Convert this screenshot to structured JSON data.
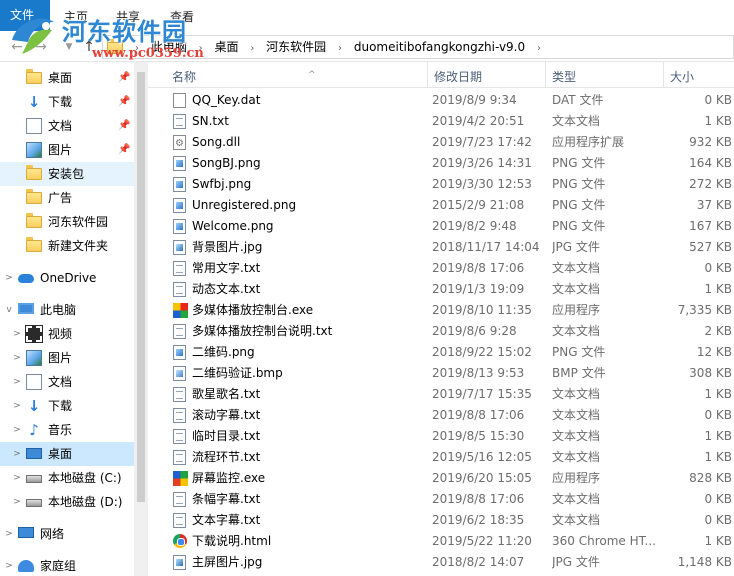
{
  "ribbon": {
    "tabs": [
      "文件",
      "主页",
      "共享",
      "查看"
    ]
  },
  "address": {
    "crumbs": [
      "此电脑",
      "桌面",
      "河东软件园",
      "duomeitibofangkongzhi-v9.0"
    ]
  },
  "watermark": {
    "title": "河东软件园",
    "url": "www.pc0359.cn"
  },
  "nav": {
    "items": [
      {
        "label": "桌面",
        "icon": "folder-icon",
        "pinned": true
      },
      {
        "label": "下载",
        "icon": "download-icon",
        "pinned": true
      },
      {
        "label": "文档",
        "icon": "document-icon",
        "pinned": true
      },
      {
        "label": "图片",
        "icon": "picture-icon",
        "pinned": true
      },
      {
        "label": "安装包",
        "icon": "folder-icon",
        "pinned": false
      },
      {
        "label": "广告",
        "icon": "folder-icon",
        "pinned": false
      },
      {
        "label": "河东软件园",
        "icon": "folder-icon",
        "pinned": false
      },
      {
        "label": "新建文件夹",
        "icon": "folder-icon",
        "pinned": false
      },
      {
        "label": "OneDrive",
        "icon": "cloud-icon",
        "pinned": false
      },
      {
        "label": "此电脑",
        "icon": "computer-icon",
        "pinned": false
      },
      {
        "label": "视频",
        "icon": "video-icon",
        "pinned": false
      },
      {
        "label": "图片",
        "icon": "picture-icon",
        "pinned": false
      },
      {
        "label": "文档",
        "icon": "document-icon",
        "pinned": false
      },
      {
        "label": "下载",
        "icon": "download-icon",
        "pinned": false
      },
      {
        "label": "音乐",
        "icon": "music-icon",
        "pinned": false
      },
      {
        "label": "桌面",
        "icon": "desktop-icon",
        "pinned": false
      },
      {
        "label": "本地磁盘 (C:)",
        "icon": "drive-icon",
        "pinned": false
      },
      {
        "label": "本地磁盘 (D:)",
        "icon": "drive-icon",
        "pinned": false
      },
      {
        "label": "网络",
        "icon": "network-icon",
        "pinned": false
      },
      {
        "label": "家庭组",
        "icon": "homegroup-icon",
        "pinned": false
      }
    ]
  },
  "columns": {
    "name": "名称",
    "date": "修改日期",
    "type": "类型",
    "size": "大小"
  },
  "files": [
    {
      "name": "QQ_Key.dat",
      "date": "2019/8/9 9:34",
      "type": "DAT 文件",
      "size": "0 KB",
      "icon": "dat"
    },
    {
      "name": "SN.txt",
      "date": "2019/4/2 20:51",
      "type": "文本文档",
      "size": "1 KB",
      "icon": "txt"
    },
    {
      "name": "Song.dll",
      "date": "2019/7/23 17:42",
      "type": "应用程序扩展",
      "size": "932 KB",
      "icon": "dll"
    },
    {
      "name": "SongBJ.png",
      "date": "2019/3/26 14:31",
      "type": "PNG 文件",
      "size": "164 KB",
      "icon": "png"
    },
    {
      "name": "Swfbj.png",
      "date": "2019/3/30 12:53",
      "type": "PNG 文件",
      "size": "272 KB",
      "icon": "png"
    },
    {
      "name": "Unregistered.png",
      "date": "2015/2/9 21:08",
      "type": "PNG 文件",
      "size": "37 KB",
      "icon": "png"
    },
    {
      "name": "Welcome.png",
      "date": "2019/8/2 9:48",
      "type": "PNG 文件",
      "size": "167 KB",
      "icon": "png"
    },
    {
      "name": "背景图片.jpg",
      "date": "2018/11/17 14:04",
      "type": "JPG 文件",
      "size": "527 KB",
      "icon": "jpg"
    },
    {
      "name": "常用文字.txt",
      "date": "2019/8/8 17:06",
      "type": "文本文档",
      "size": "0 KB",
      "icon": "txt"
    },
    {
      "name": "动态文本.txt",
      "date": "2019/1/3 19:09",
      "type": "文本文档",
      "size": "1 KB",
      "icon": "txt"
    },
    {
      "name": "多媒体播放控制台.exe",
      "date": "2019/8/10 11:35",
      "type": "应用程序",
      "size": "7,335 KB",
      "icon": "exe1"
    },
    {
      "name": "多媒体播放控制台说明.txt",
      "date": "2019/8/6 9:28",
      "type": "文本文档",
      "size": "2 KB",
      "icon": "txt"
    },
    {
      "name": "二维码.png",
      "date": "2018/9/22 15:02",
      "type": "PNG 文件",
      "size": "12 KB",
      "icon": "png"
    },
    {
      "name": "二维码验证.bmp",
      "date": "2019/8/13 9:53",
      "type": "BMP 文件",
      "size": "308 KB",
      "icon": "bmp"
    },
    {
      "name": "歌星歌名.txt",
      "date": "2019/7/17 15:35",
      "type": "文本文档",
      "size": "1 KB",
      "icon": "txt"
    },
    {
      "name": "滚动字幕.txt",
      "date": "2019/8/8 17:06",
      "type": "文本文档",
      "size": "0 KB",
      "icon": "txt"
    },
    {
      "name": "临时目录.txt",
      "date": "2019/8/5 15:30",
      "type": "文本文档",
      "size": "1 KB",
      "icon": "txt"
    },
    {
      "name": "流程环节.txt",
      "date": "2019/5/16 12:05",
      "type": "文本文档",
      "size": "1 KB",
      "icon": "txt"
    },
    {
      "name": "屏幕监控.exe",
      "date": "2019/6/20 15:05",
      "type": "应用程序",
      "size": "828 KB",
      "icon": "exe2"
    },
    {
      "name": "条幅字幕.txt",
      "date": "2019/8/8 17:06",
      "type": "文本文档",
      "size": "0 KB",
      "icon": "txt"
    },
    {
      "name": "文本字幕.txt",
      "date": "2019/6/2 18:35",
      "type": "文本文档",
      "size": "0 KB",
      "icon": "txt"
    },
    {
      "name": "下载说明.html",
      "date": "2019/5/22 11:20",
      "type": "360 Chrome HT...",
      "size": "1 KB",
      "icon": "html"
    },
    {
      "name": "主屏图片.jpg",
      "date": "2018/8/2 14:07",
      "type": "JPG 文件",
      "size": "1,148 KB",
      "icon": "jpg"
    }
  ]
}
